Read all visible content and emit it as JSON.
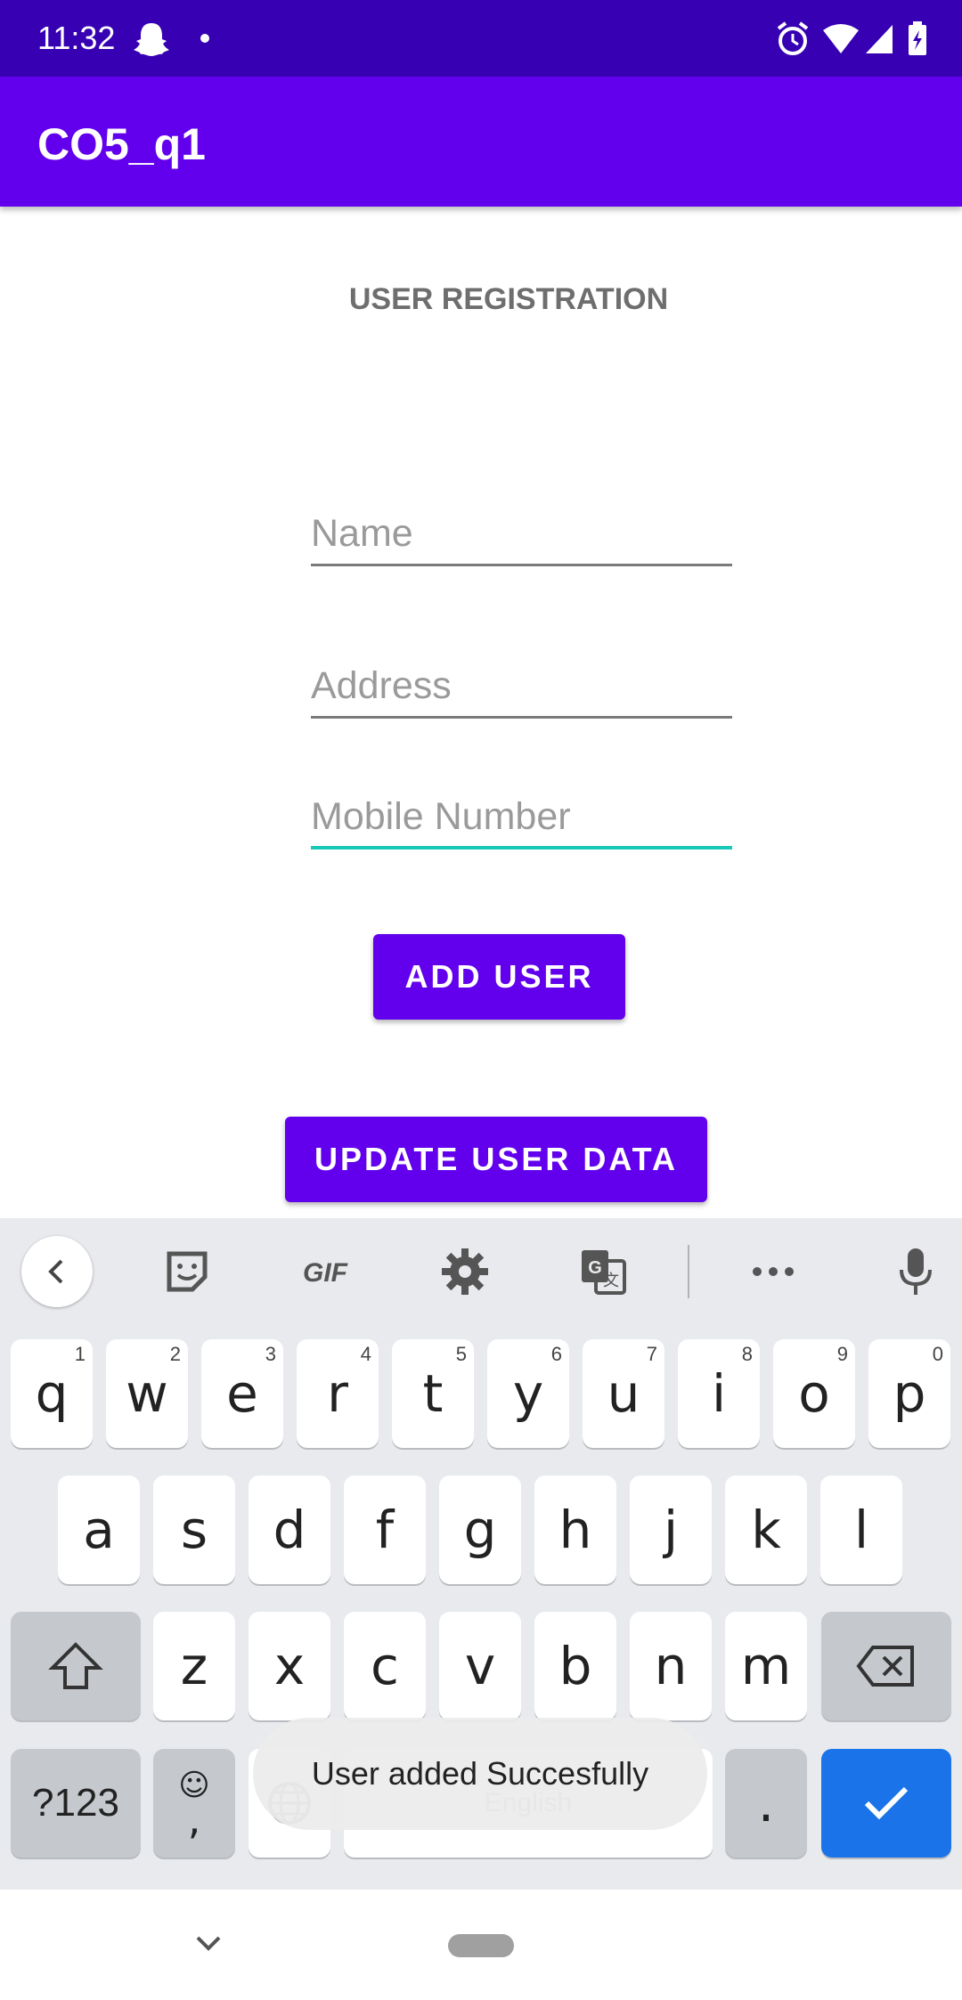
{
  "status_bar": {
    "time": "11:32"
  },
  "app_bar": {
    "title": "CO5_q1"
  },
  "form": {
    "heading": "USER REGISTRATION",
    "name_placeholder": "Name",
    "address_placeholder": "Address",
    "mobile_placeholder": "Mobile Number",
    "add_button": "ADD USER",
    "update_button": "UPDATE USER DATA"
  },
  "keyboard": {
    "row1": [
      {
        "key": "q",
        "hint": "1"
      },
      {
        "key": "w",
        "hint": "2"
      },
      {
        "key": "e",
        "hint": "3"
      },
      {
        "key": "r",
        "hint": "4"
      },
      {
        "key": "t",
        "hint": "5"
      },
      {
        "key": "y",
        "hint": "6"
      },
      {
        "key": "u",
        "hint": "7"
      },
      {
        "key": "i",
        "hint": "8"
      },
      {
        "key": "o",
        "hint": "9"
      },
      {
        "key": "p",
        "hint": "0"
      }
    ],
    "row2": [
      "a",
      "s",
      "d",
      "f",
      "g",
      "h",
      "j",
      "k",
      "l"
    ],
    "row3": [
      "z",
      "x",
      "c",
      "v",
      "b",
      "n",
      "m"
    ],
    "symbols_key": "?123",
    "emoji_key": "☺",
    "comma_key": ",",
    "period_key": ".",
    "space_label": "English",
    "accent_color": "#1a73e8"
  },
  "toast": {
    "message": "User added Succesfully"
  },
  "colors": {
    "primary": "#6200ee",
    "primary_dark": "#3700b3",
    "focus": "#18c8b8"
  }
}
